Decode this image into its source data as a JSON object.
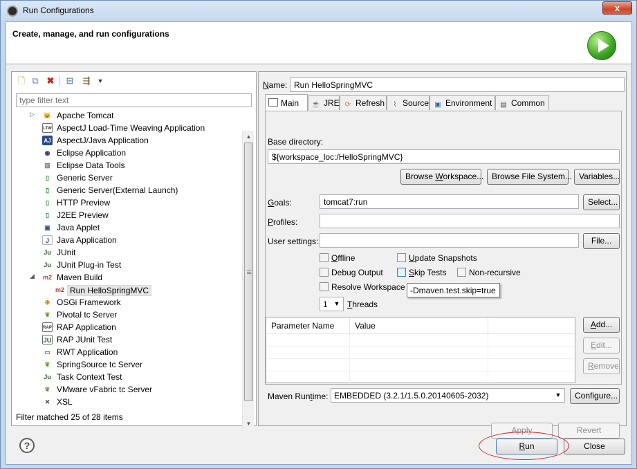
{
  "window": {
    "title": "Run Configurations",
    "close_glyph": "x"
  },
  "header": {
    "title": "Create, manage, and run configurations"
  },
  "left": {
    "filter_placeholder": "type filter text",
    "items": [
      {
        "label": "Apache Tomcat",
        "icon": "tomcat-icon",
        "expander": "▷",
        "level": 0
      },
      {
        "label": "AspectJ Load-Time Weaving Application",
        "icon": "ltw-icon",
        "glyph": "LTW",
        "level": 0
      },
      {
        "label": "AspectJ/Java Application",
        "icon": "aj-icon",
        "glyph": "AJ",
        "level": 0
      },
      {
        "label": "Eclipse Application",
        "icon": "eclipse-icon",
        "level": 0
      },
      {
        "label": "Eclipse Data Tools",
        "icon": "database-icon",
        "level": 0
      },
      {
        "label": "Generic Server",
        "icon": "server-icon",
        "level": 0
      },
      {
        "label": "Generic Server(External Launch)",
        "icon": "server-icon",
        "level": 0
      },
      {
        "label": "HTTP Preview",
        "icon": "server-icon",
        "level": 0
      },
      {
        "label": "J2EE Preview",
        "icon": "server-icon",
        "level": 0
      },
      {
        "label": "Java Applet",
        "icon": "applet-icon",
        "level": 0
      },
      {
        "label": "Java Application",
        "icon": "java-icon",
        "glyph": "J",
        "level": 0
      },
      {
        "label": "JUnit",
        "icon": "junit-icon",
        "glyph": "Ju",
        "level": 0
      },
      {
        "label": "JUnit Plug-in Test",
        "icon": "junit-plugin-icon",
        "glyph": "Ju",
        "level": 0
      },
      {
        "label": "Maven Build",
        "icon": "maven-icon",
        "glyph": "m2",
        "expander": "◢",
        "level": 0
      },
      {
        "label": "Run HelloSpringMVC",
        "icon": "maven-icon",
        "glyph": "m2",
        "level": 1,
        "selected": true
      },
      {
        "label": "OSGi Framework",
        "icon": "osgi-icon",
        "level": 0
      },
      {
        "label": "Pivotal tc Server",
        "icon": "spring-icon",
        "level": 0
      },
      {
        "label": "RAP Application",
        "icon": "rap-icon",
        "glyph": "RAP",
        "level": 0
      },
      {
        "label": "RAP JUnit Test",
        "icon": "rap-junit-icon",
        "glyph": "JU",
        "level": 0
      },
      {
        "label": "RWT Application",
        "icon": "rwt-icon",
        "level": 0
      },
      {
        "label": "SpringSource tc Server",
        "icon": "spring-icon",
        "level": 0
      },
      {
        "label": "Task Context Test",
        "icon": "task-junit-icon",
        "glyph": "Ju",
        "level": 0
      },
      {
        "label": "VMware vFabric tc Server",
        "icon": "spring-icon",
        "level": 0
      },
      {
        "label": "XSL",
        "icon": "xsl-icon",
        "glyph": "✕",
        "level": 0
      }
    ],
    "status": "Filter matched 25 of 28 items"
  },
  "right": {
    "name_label_u": "N",
    "name_label_rest": "ame:",
    "name_value": "Run HelloSpringMVC",
    "tabs": [
      {
        "label": "Main",
        "icon": "main-tab-icon"
      },
      {
        "label": "JRE",
        "icon": "jre-tab-icon"
      },
      {
        "label": "Refresh",
        "icon": "refresh-tab-icon"
      },
      {
        "label": "Source",
        "icon": "source-tab-icon"
      },
      {
        "label": "Environment",
        "icon": "environment-tab-icon"
      },
      {
        "label": "Common",
        "icon": "common-tab-icon"
      }
    ],
    "base_dir_label": "Base directory:",
    "base_dir_value": "${workspace_loc:/HelloSpringMVC}",
    "browse_workspace": {
      "pre": "Browse ",
      "u": "W",
      "post": "orkspace..."
    },
    "browse_fs": {
      "pre": "Browse File System",
      "u": "",
      "post": "..."
    },
    "variables": {
      "pre": "Variables...",
      "u": "",
      "post": ""
    },
    "goals_label": {
      "u": "G",
      "rest": "oals:"
    },
    "goals_value": "tomcat7:run",
    "select_button": {
      "pre": "Select",
      "u": "",
      "post": "..."
    },
    "profiles_label": {
      "u": "P",
      "rest": "rofiles:"
    },
    "profiles_value": "",
    "user_settings_label": "User settings:",
    "user_settings_value": "",
    "file_button": "File...",
    "checkboxes": {
      "offline": {
        "u": "O",
        "rest": "ffline",
        "checked": false
      },
      "update_snapshots": {
        "u": "U",
        "rest": "pdate Snapshots",
        "checked": false
      },
      "debug_output": {
        "pre": "Debu",
        "u": "g",
        "post": " Output",
        "checked": false
      },
      "skip_tests": {
        "u": "S",
        "rest": "kip Tests",
        "checked": false
      },
      "non_recursive": {
        "label": "Non-recursive",
        "checked": false
      },
      "resolve_workspace": {
        "label": "Resolve Workspace",
        "checked": false
      }
    },
    "tooltip": "-Dmaven.test.skip=true",
    "threads_value": "1",
    "threads_label": {
      "u": "T",
      "rest": "hreads"
    },
    "param_headers": [
      "Parameter Name",
      "Value"
    ],
    "add_button": {
      "u": "A",
      "rest": "dd..."
    },
    "edit_button": {
      "u": "E",
      "rest": "dit..."
    },
    "remove_button": {
      "u": "R",
      "rest": "emove"
    },
    "maven_runtime_label": {
      "pre": "Maven Run",
      "u": "t",
      "post": "ime:"
    },
    "maven_runtime_value": "EMBEDDED (3.2.1/1.5.0.20140605-2032)",
    "configure_button": "Configure...",
    "apply_button": "Apply",
    "revert_button": "Revert"
  },
  "footer": {
    "help": "?",
    "run_button": {
      "u": "R",
      "rest": "un"
    },
    "close_button": "Close"
  },
  "colors": {
    "highlight_ellipse": "#d3212c",
    "maven_icon": "#c0392b",
    "titlebar": "#c5d8ef"
  }
}
